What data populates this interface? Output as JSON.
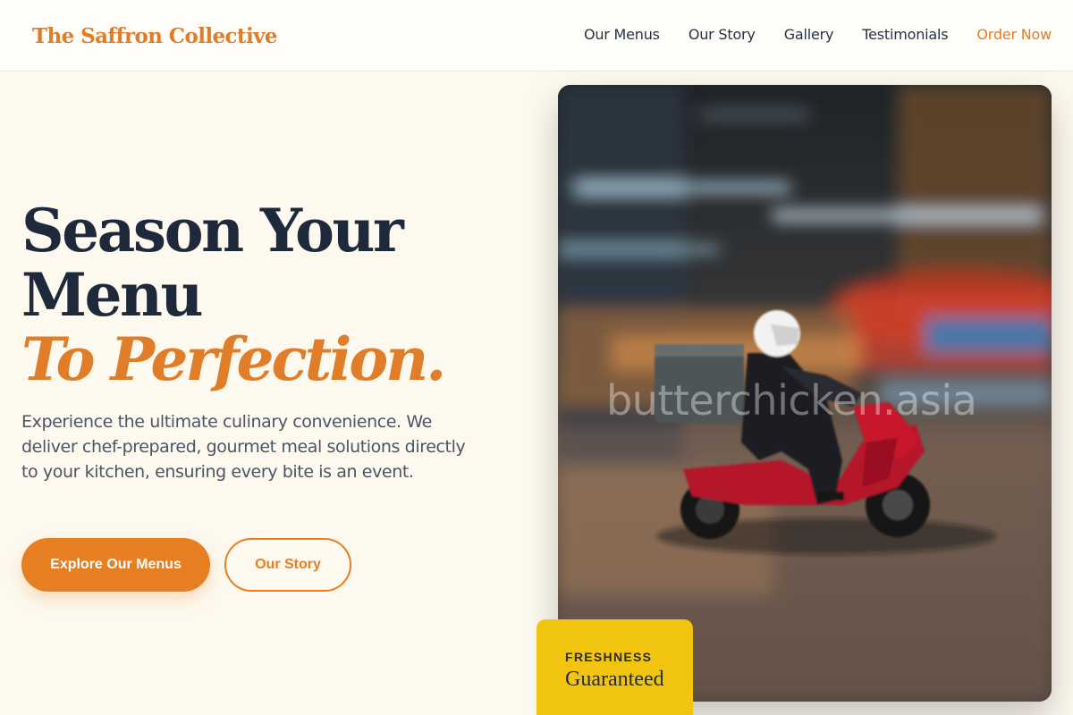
{
  "brand": {
    "name": "The Saffron Collective"
  },
  "nav": {
    "items": [
      "Our Menus",
      "Our Story",
      "Gallery",
      "Testimonials"
    ],
    "cta": "Order Now"
  },
  "hero": {
    "title_line1": "Season Your",
    "title_line2": "Menu",
    "title_italic": "To Perfection.",
    "description": "Experience the ultimate culinary convenience. We deliver chef-prepared, gourmet meal solutions directly to your kitchen, ensuring every bite is an event.",
    "primary_button": "Explore Our Menus",
    "secondary_button": "Our Story"
  },
  "image": {
    "watermark": "butterchicken.asia"
  },
  "badge": {
    "kicker": "FRESHNESS",
    "value": "Guaranteed"
  },
  "colors": {
    "accent": "#e67e22",
    "heading": "#1e2a3b",
    "background": "#fdf9ef",
    "badge": "#f1c40f"
  }
}
